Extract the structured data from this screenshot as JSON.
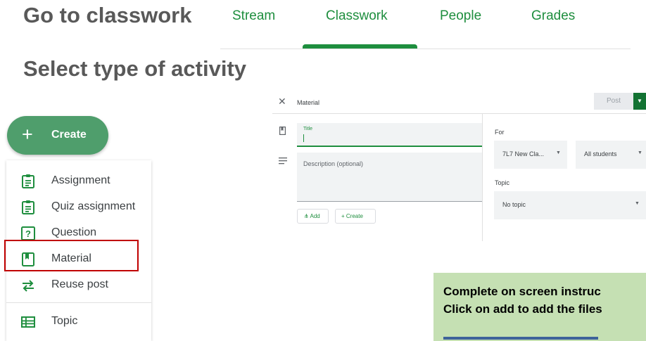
{
  "headings": {
    "goto": "Go to classwork",
    "select": "Select type of activity"
  },
  "tabs": [
    {
      "label": "Stream"
    },
    {
      "label": "Classwork",
      "active": true
    },
    {
      "label": "People"
    },
    {
      "label": "Grades"
    }
  ],
  "create_button": {
    "label": "Create",
    "icon": "plus-icon"
  },
  "menu": {
    "items": [
      {
        "label": "Assignment",
        "icon": "assignment-icon"
      },
      {
        "label": "Quiz assignment",
        "icon": "quiz-assignment-icon"
      },
      {
        "label": "Question",
        "icon": "question-icon"
      },
      {
        "label": "Material",
        "icon": "material-icon",
        "highlighted": true
      },
      {
        "label": "Reuse post",
        "icon": "reuse-icon"
      },
      {
        "label": "Topic",
        "icon": "topic-icon"
      }
    ]
  },
  "editor": {
    "close_icon": "close-icon",
    "title": "Material",
    "post_label": "Post",
    "title_label": "Title",
    "description_placeholder": "Description (optional)",
    "add_label": "Add",
    "create_label": "Create",
    "for_label": "For",
    "class_value": "7L7 New Cla...",
    "students_value": "All students",
    "topic_label": "Topic",
    "topic_value": "No topic"
  },
  "note": {
    "line1": "Complete on screen instruc",
    "line2": "Click on add to add the files"
  },
  "colors": {
    "accent": "#1e8e3e",
    "create_button": "#4f9e6c",
    "note_background": "#c5e0b3",
    "highlight_border": "#c00000"
  }
}
